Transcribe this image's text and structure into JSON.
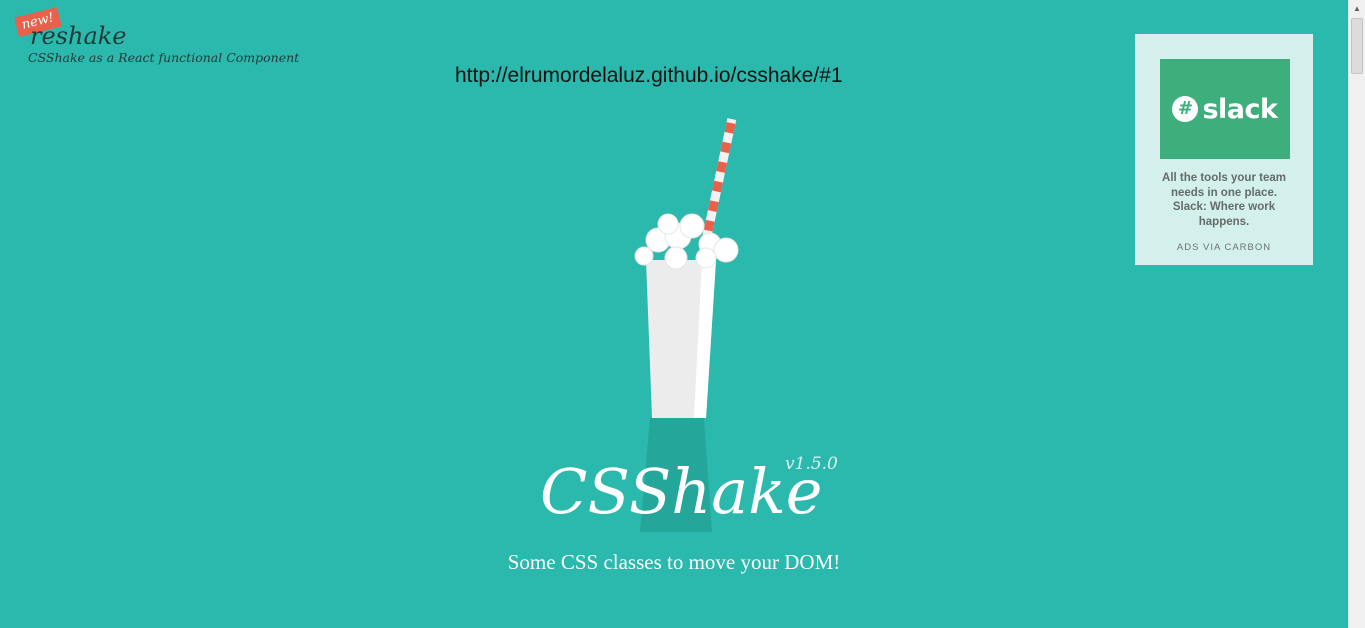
{
  "promo": {
    "badge": "new!",
    "name": "reshake",
    "tagline": "CSShake as a React functional Component"
  },
  "url_text": "http://elrumordelaluz.github.io/csshake/#1",
  "hero": {
    "title": "CSShake",
    "version": "v1.5.0",
    "subtitle": "Some CSS classes to move your DOM!"
  },
  "ad": {
    "brand": "slack",
    "text": "All the tools your team needs in one place. Slack: Where work happens.",
    "via": "ADS VIA CARBON"
  },
  "colors": {
    "background": "#2bb8ad",
    "straw_stripe": "#e8614b",
    "slack_green": "#3eaf7c",
    "ad_bg": "#d4f0ec"
  },
  "icons": {
    "shake": "milkshake-illustration",
    "slack_logo": "slack-hash-icon",
    "scroll_up": "scroll-up-arrow-icon"
  }
}
